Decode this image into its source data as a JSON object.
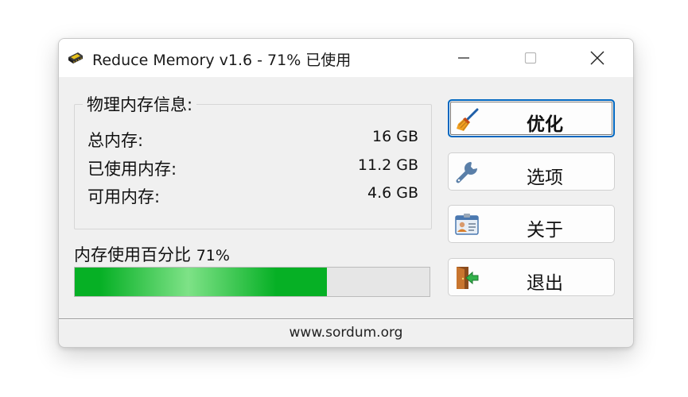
{
  "window": {
    "title": "Reduce Memory v1.6 - 71% 已使用"
  },
  "memory_info": {
    "group_title": "物理内存信息:",
    "rows": [
      {
        "label": "总内存:",
        "value": "16 GB"
      },
      {
        "label": "已使用内存:",
        "value": "11.2 GB"
      },
      {
        "label": "可用内存:",
        "value": "4.6 GB"
      }
    ]
  },
  "usage": {
    "label": "内存使用百分比",
    "percent_text": "71%",
    "percent": 71,
    "bar_color": "#06b025"
  },
  "buttons": {
    "optimize": "优化",
    "options": "选项",
    "about": "关于",
    "exit": "退出"
  },
  "icons": {
    "app": "memory-chip-icon",
    "optimize": "broom-icon",
    "options": "wrench-icon",
    "about": "id-card-icon",
    "exit": "exit-door-icon"
  },
  "statusbar": {
    "text": "www.sordum.org"
  }
}
